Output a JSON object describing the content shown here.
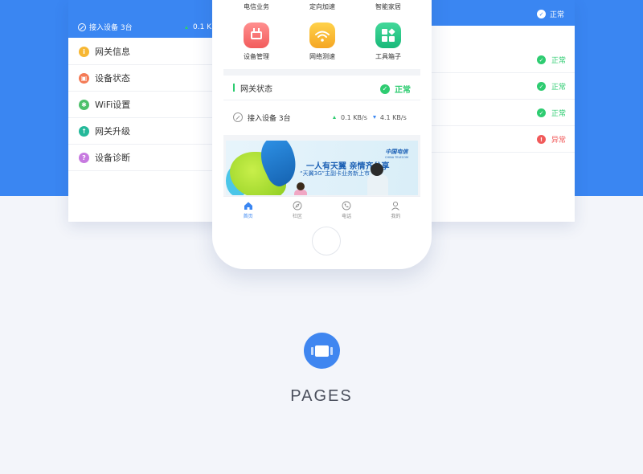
{
  "left_panel": {
    "connected_label": "接入设备 3台",
    "speed": "0.1 KB/s",
    "menu": [
      {
        "label": "网关信息",
        "icon": "info-icon",
        "color": "#f7b733"
      },
      {
        "label": "设备状态",
        "icon": "device-icon",
        "color": "#f47a55"
      },
      {
        "label": "WiFi设置",
        "icon": "gear-icon",
        "color": "#4cc06a"
      },
      {
        "label": "网关升级",
        "icon": "upgrade-icon",
        "color": "#24b99a"
      },
      {
        "label": "设备诊断",
        "icon": "question-icon",
        "color": "#c77ae0"
      }
    ]
  },
  "right_panel": {
    "header_status": "正常",
    "rows": [
      {
        "status": "正常",
        "kind": "ok"
      },
      {
        "status": "正常",
        "kind": "ok"
      },
      {
        "status": "正常",
        "kind": "ok"
      },
      {
        "status": "异常",
        "kind": "error"
      }
    ]
  },
  "phone": {
    "grid_top_labels": [
      "电信业务",
      "定向加速",
      "智能家居"
    ],
    "tiles": [
      {
        "label": "设备管理",
        "icon": "router-icon"
      },
      {
        "label": "网络测速",
        "icon": "wifi-icon"
      },
      {
        "label": "工具箱子",
        "icon": "toolbox-icon"
      }
    ],
    "gateway": {
      "title": "网关状态",
      "status": "正常",
      "connected": "接入设备 3台",
      "upload": "0.1 KB/s",
      "download": "4.1 KB/s"
    },
    "banner": {
      "slogan": "一人有天翼 亲情齐分享",
      "sub": "“天翼3G”主副卡业务新上市",
      "logo_cn": "中国电信",
      "logo_en": "CHINA TELECOM"
    },
    "tabs": [
      {
        "label": "首页",
        "icon": "home-icon",
        "active": true
      },
      {
        "label": "社区",
        "icon": "compass-icon",
        "active": false
      },
      {
        "label": "电话",
        "icon": "phone-icon",
        "active": false
      },
      {
        "label": "我的",
        "icon": "user-icon",
        "active": false
      }
    ]
  },
  "footer": {
    "title": "PAGES",
    "icon": "pages-icon"
  },
  "colors": {
    "primary": "#3a86f2",
    "success": "#2ecc71",
    "error": "#f15a5a",
    "background": "#f3f5fa"
  }
}
